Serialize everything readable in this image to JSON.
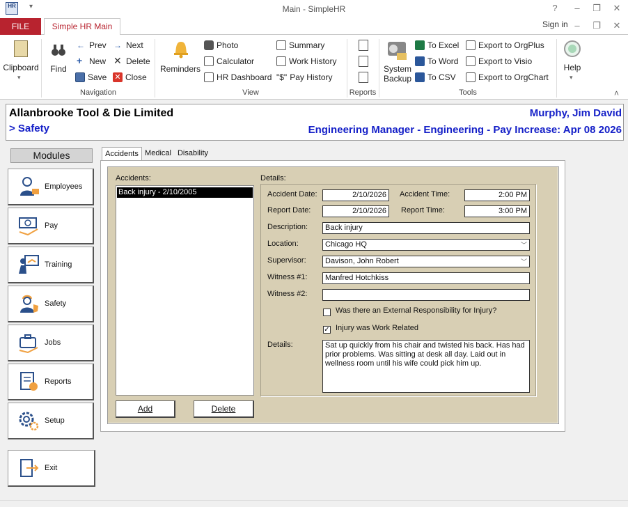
{
  "window": {
    "title": "Main - SimpleHR",
    "app_icon_text": "HR",
    "qat_symbol": "▾",
    "help": "?",
    "minimize": "–",
    "restore": "❐",
    "close": "✕"
  },
  "ribbon": {
    "file_tab": "FILE",
    "main_tab": "Simple HR Main",
    "signin": "Sign in",
    "collapse_arrow": "˄",
    "groups": {
      "navigation": "Navigation",
      "view": "View",
      "reports": "Reports",
      "tools": "Tools"
    },
    "clipboard": "Clipboard",
    "find": "Find",
    "prev": "Prev",
    "next": "Next",
    "new": "New",
    "delete": "Delete",
    "save": "Save",
    "close": "Close",
    "reminders": "Reminders",
    "photo": "Photo",
    "calculator": "Calculator",
    "hr_dashboard": "HR Dashboard",
    "summary": "Summary",
    "work_history": "Work History",
    "pay_history_glyph": "\"$\"",
    "pay_history": "Pay History",
    "system_backup_1": "System",
    "system_backup_2": "Backup",
    "to_excel": "To Excel",
    "to_word": "To Word",
    "to_csv": "To CSV",
    "export_orgplus": "Export to OrgPlus",
    "export_visio": "Export to Visio",
    "export_orgchart": "Export to OrgChart",
    "help": "Help"
  },
  "header": {
    "company": "Allanbrooke Tool & Die Limited",
    "breadcrumb": "> Safety",
    "employee_name": "Murphy, Jim David",
    "employee_info": "Engineering Manager - Engineering - Pay Increase: Apr 08 2026"
  },
  "modules": {
    "title": "Modules",
    "items": [
      "Employees",
      "Pay",
      "Training",
      "Safety",
      "Jobs",
      "Reports",
      "Setup"
    ],
    "exit": "Exit"
  },
  "tabs": [
    "Accidents",
    "Medical",
    "Disability"
  ],
  "accidents": {
    "list_label": "Accidents:",
    "items": [
      "Back injury - 2/10/2005"
    ],
    "add": "Add",
    "delete": "Delete"
  },
  "details": {
    "label": "Details:",
    "accident_date_label": "Accident Date:",
    "accident_date": "2/10/2026",
    "accident_time_label": "Accident Time:",
    "accident_time": "2:00 PM",
    "report_date_label": "Report Date:",
    "report_date": "2/10/2026",
    "report_time_label": "Report Time:",
    "report_time": "3:00 PM",
    "description_label": "Description:",
    "description": "Back injury",
    "location_label": "Location:",
    "location": "Chicago HQ",
    "supervisor_label": "Supervisor:",
    "supervisor": "Davison, John Robert",
    "witness1_label": "Witness #1:",
    "witness1": "Manfred Hotchkiss",
    "witness2_label": "Witness #2:",
    "witness2": "",
    "external_resp_label": "Was there an External Responsibility for Injury?",
    "work_related_label": "Injury was Work Related",
    "work_related_mark": "✓",
    "notes_label": "Details:",
    "notes": "Sat up quickly from his chair and twisted his back. Has had prior problems. Was sitting at desk all day. Laid out in wellness room until his wife could pick him up."
  },
  "colors": {
    "file_tab": "#b8232f",
    "header_blue": "#1520c8",
    "panel_beige": "#d8cfb4"
  }
}
